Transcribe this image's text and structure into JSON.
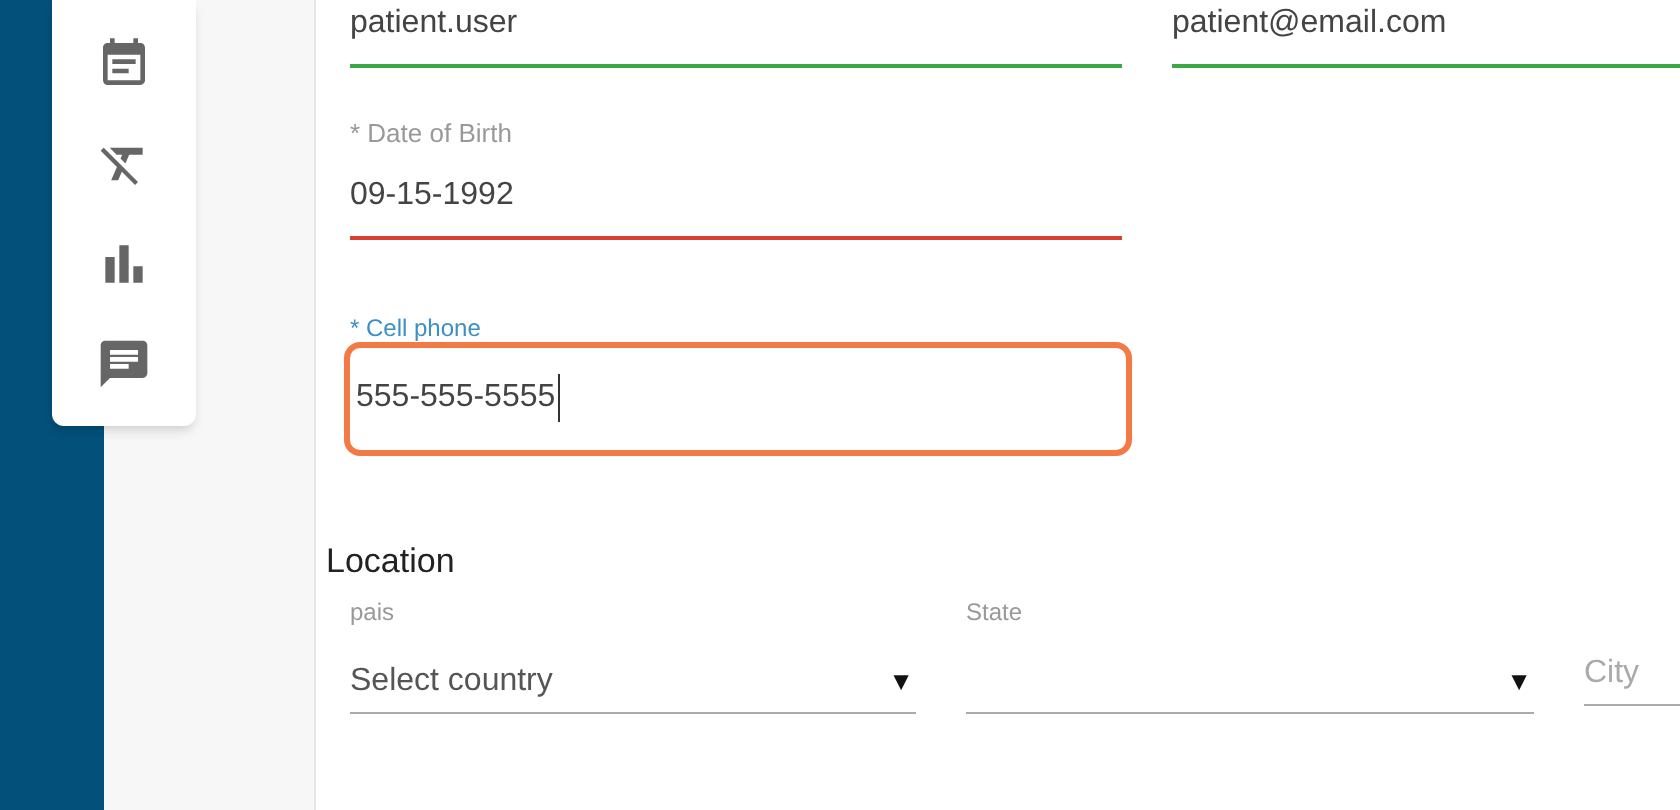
{
  "toolbar": {
    "items": [
      {
        "kind": "calendar"
      },
      {
        "kind": "clear-format"
      },
      {
        "kind": "chart"
      },
      {
        "kind": "message"
      }
    ]
  },
  "account": [
    {
      "value": "patient.user",
      "error": false
    },
    {
      "value": "patient@email.com",
      "error": false
    }
  ],
  "date_of_birth": {
    "label": "* Date of Birth",
    "value": "09-15-1992",
    "error": true
  },
  "cell_phone": {
    "label": "* Cell phone",
    "value": "555-555-5555",
    "highlighted": true
  },
  "location": {
    "title": "Location",
    "fields": [
      {
        "kind": "select",
        "label": "pais",
        "value": "Select country",
        "arrow": "▼"
      },
      {
        "kind": "select",
        "label": "State",
        "arrow": "▼"
      },
      {
        "kind": "text",
        "placeholder": "City"
      }
    ]
  }
}
